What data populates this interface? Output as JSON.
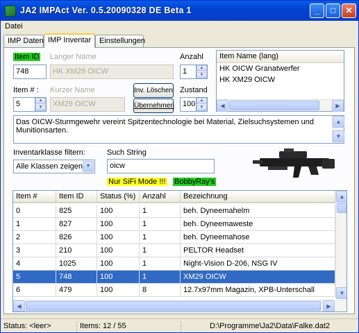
{
  "window": {
    "title": "JA2 IMPAct Ver. 0.5.20090328 DE Beta 1"
  },
  "menu": {
    "file": "Datei"
  },
  "tabs": [
    "IMP Daten",
    "IMP Inventar",
    "Einstellungen"
  ],
  "form": {
    "item_id_label": "Item ID",
    "item_id_value": "748",
    "long_name_label": "Langer Name",
    "long_name_value": "HK XM29 OICW",
    "quantity_label": "Anzahl",
    "quantity_value": "1",
    "item_num_label": "Item # :",
    "item_num_value": "5",
    "short_name_label": "Kurzer Name",
    "short_name_value": "XM29 OICW",
    "inv_delete_button": "Inv. Löschen",
    "apply_button": "Übernehmen",
    "condition_label": "Zustand",
    "condition_value": "100"
  },
  "name_list": {
    "header": "Item Name (lang)",
    "items": [
      "HK OICW Granatwerfer",
      "HK XM29 OICW"
    ]
  },
  "description": "Das OICW-Sturmgewehr vereint Spitzentechnologie bei Material, Zielsuchsystemen und Munitionsarten.",
  "filter": {
    "class_label": "Inventarklasse filtern:",
    "class_value": "Alle Klassen zeigen",
    "search_label": "Such String",
    "search_value": "oicw",
    "scifi_label": "Nur SiFi Mode !!!",
    "bobbyray_label": "BobbyRay's"
  },
  "table": {
    "columns": [
      "Item #",
      "Item ID",
      "Status (%)",
      "Anzahl",
      "Bezeichnung"
    ],
    "rows": [
      [
        "0",
        "825",
        "100",
        "1",
        "beh. Dyneemahelm"
      ],
      [
        "1",
        "827",
        "100",
        "1",
        "beh. Dyneemaweste"
      ],
      [
        "2",
        "826",
        "100",
        "1",
        "beh. Dyneemahose"
      ],
      [
        "3",
        "210",
        "100",
        "1",
        "PELTOR Headset"
      ],
      [
        "4",
        "1025",
        "100",
        "1",
        "Night-Vision D-206, NSG IV"
      ],
      [
        "5",
        "748",
        "100",
        "1",
        "XM29 OICW"
      ],
      [
        "6",
        "479",
        "100",
        "8",
        "12.7x97mm Magazin, XPB-Unterschall"
      ]
    ],
    "selected_row": 5
  },
  "status": {
    "status": "Status: <leer>",
    "items": "Items: 12 / 55",
    "path": "D:\\Programme\\Ja2\\Data\\Falke.dat2"
  },
  "colors": {
    "title_blue": "#0a5ce6",
    "selection": "#316ac5",
    "highlight_green": "#22cc22",
    "highlight_yellow": "#ffff22"
  }
}
